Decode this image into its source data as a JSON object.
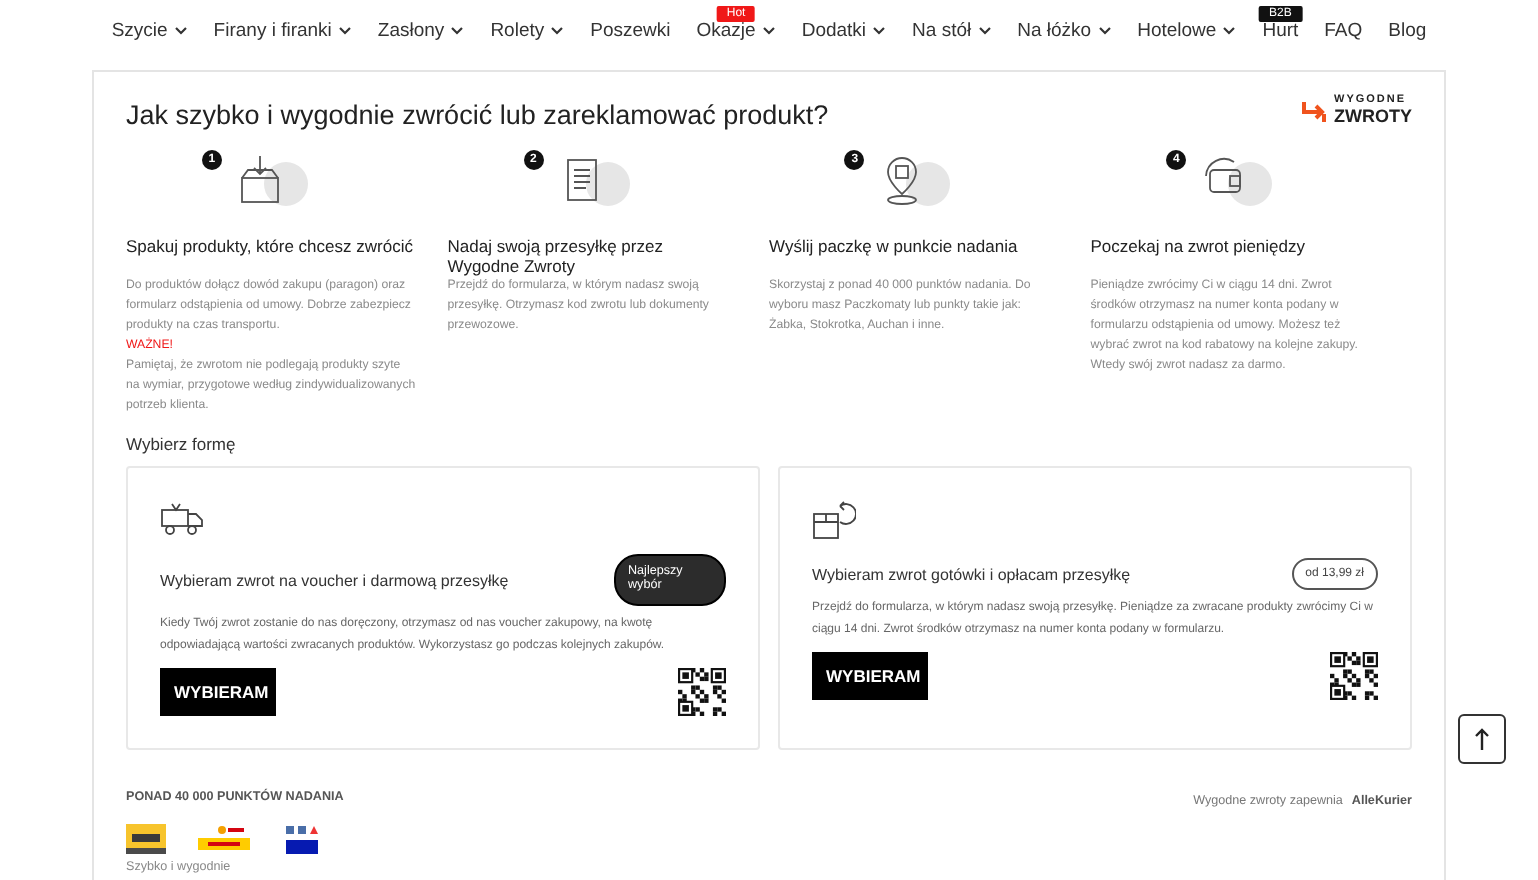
{
  "nav": [
    {
      "label": "Szycie",
      "dropdown": true
    },
    {
      "label": "Firany i firanki",
      "dropdown": true
    },
    {
      "label": "Zasłony",
      "dropdown": true
    },
    {
      "label": "Rolety",
      "dropdown": true
    },
    {
      "label": "Poszewki",
      "dropdown": false
    },
    {
      "label": "Okazje",
      "dropdown": true,
      "badge": {
        "text": "Hot",
        "kind": "hot"
      }
    },
    {
      "label": "Dodatki",
      "dropdown": true
    },
    {
      "label": "Na stół",
      "dropdown": true
    },
    {
      "label": "Na łóżko",
      "dropdown": true
    },
    {
      "label": "Hotelowe",
      "dropdown": true
    },
    {
      "label": "Hurt",
      "dropdown": false,
      "badge": {
        "text": "B2B",
        "kind": "b2b"
      }
    },
    {
      "label": "FAQ",
      "dropdown": false
    },
    {
      "label": "Blog",
      "dropdown": false
    }
  ],
  "title": "Jak szybko i wygodnie zwrócić lub zareklamować produkt?",
  "logo": {
    "top": "WYGODNE",
    "bottom": "ZWROTY"
  },
  "steps": [
    {
      "number": "1",
      "kind": "box",
      "title": "Spakuj produkty, które chcesz zwrócić",
      "paragraphs": [
        {
          "kind": "normal",
          "text": "Do produktów dołącz dowód zakupu (paragon) oraz formularz odstąpienia od umowy. Dobrze zabezpiecz produkty na czas transportu."
        },
        {
          "kind": "warning",
          "text": "WAŻNE!"
        },
        {
          "kind": "normal",
          "text": "Pamiętaj, że zwrotom nie podlegają produkty szyte na wymiar, przygotowe według zindywidualizowanych potrzeb klienta."
        }
      ]
    },
    {
      "number": "2",
      "kind": "form",
      "title": "Nadaj swoją przesyłkę przez Wygodne Zwroty",
      "paragraphs": [
        {
          "kind": "normal",
          "text": "Przejdź do formularza, w którym nadasz swoją przesyłkę. Otrzymasz kod zwrotu lub dokumenty przewozowe."
        }
      ]
    },
    {
      "number": "3",
      "kind": "pin",
      "title": "Wyślij paczkę w punkcie nadania",
      "paragraphs": [
        {
          "kind": "normal",
          "text": "Skorzystaj z ponad 40 000 punktów nadania. Do wyboru masz Paczkomaty lub punkty takie jak: Żabka, Stokrotka, Auchan i inne."
        }
      ]
    },
    {
      "number": "4",
      "kind": "wallet",
      "title": "Poczekaj na zwrot pieniędzy",
      "paragraphs": [
        {
          "kind": "normal",
          "text": "Pieniądze zwrócimy Ci w ciągu 14 dni. Zwrot środków otrzymasz na numer konta podany w formularzu odstąpienia od umowy. Możesz też wybrać zwrot na kod rabatowy na kolejne zakupy. Wtedy swój zwrot nadasz za darmo."
        }
      ]
    }
  ],
  "choose_label": "Wybierz formę",
  "options": [
    {
      "kind": "truck",
      "title": "Wybieram zwrot na voucher i darmową przesyłkę",
      "badge": {
        "kind": "dark",
        "text": "Najlepszy wybór"
      },
      "text": "Kiedy Twój zwrot zostanie do nas doręczony, otrzymasz od nas voucher zakupowy, na kwotę odpowiadającą wartości zwracanych produktów. Wykorzystasz go podczas kolejnych zakupów.",
      "button": "WYBIERAM"
    },
    {
      "kind": "parcel",
      "title": "Wybieram zwrot gotówki i opłacam przesyłkę",
      "badge": {
        "kind": "outline",
        "text": "od 13,99 zł"
      },
      "text": "Przejdź do formularza, w którym nadasz swoją przesyłkę. Pieniądze za zwracane produkty zwrócimy Ci w ciągu 14 dni. Zwrot środków otrzymasz na numer konta podany w formularzu.",
      "button": "WYBIERAM"
    }
  ],
  "footer": {
    "points_label": "PONAD 40 000 PUNKTÓW NADANIA",
    "carriers": [
      {
        "kind": "inpost"
      },
      {
        "kind": "dhl"
      },
      {
        "kind": "gls"
      }
    ],
    "provider_text": "Wygodne zwroty zapewnia",
    "provider_name": "AlleKurier",
    "tagline": "Szybko i wygodnie"
  }
}
